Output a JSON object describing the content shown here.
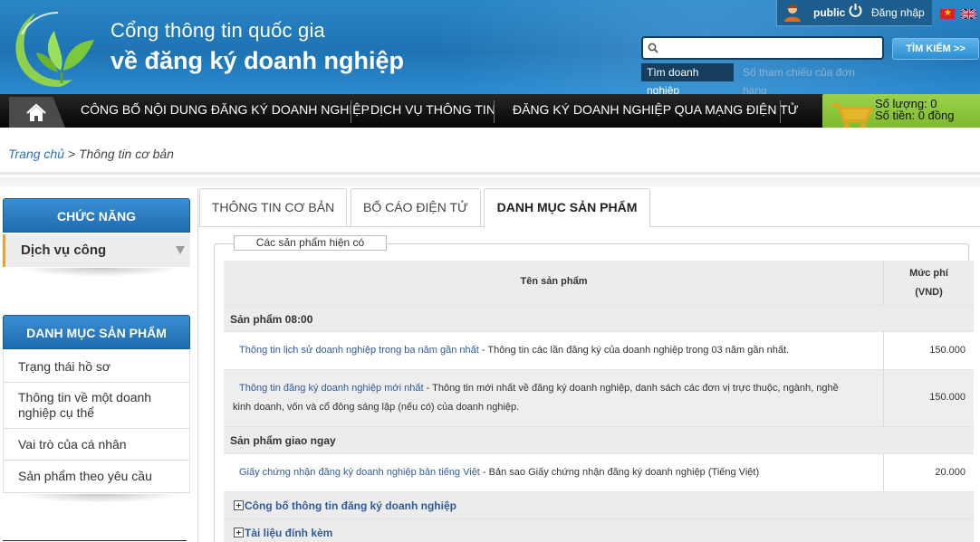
{
  "header": {
    "title_line1": "Cổng thông tin quốc gia",
    "title_line2": "về đăng ký doanh nghiệp",
    "user_name": "public",
    "login_label": "Đăng nhập",
    "search": {
      "placeholder": "",
      "button_label": "TÌM KIẾM >>",
      "tab_company": "Tìm doanh nghiệp",
      "tab_order_ref": "Số tham chiếu của đơn hàng"
    }
  },
  "nav": {
    "items": [
      {
        "label": "CÔNG BỐ NỘI DUNG ĐĂNG KÝ DOANH NGHIỆP"
      },
      {
        "label": "DỊCH VỤ THÔNG TIN"
      },
      {
        "label": "ĐĂNG KÝ DOANH NGHIỆP QUA MẠNG ĐIỆN TỬ"
      }
    ]
  },
  "cart": {
    "quantity": "Số lượng: 0",
    "amount": "Số tiền: 0 đồng"
  },
  "breadcrumb": {
    "home": "Trang chủ",
    "separator": " > ",
    "current": "Thông tin cơ bản"
  },
  "sidebar": {
    "functions_title": "CHỨC NĂNG",
    "functions_item": "Dịch vụ công",
    "products_title": "DANH MỤC SẢN PHẨM",
    "products_items": [
      {
        "label": "Trạng thái hồ sơ"
      },
      {
        "label": "Thông tin về một doanh nghiệp cụ thể"
      },
      {
        "label": "Vai trò của cá nhân"
      },
      {
        "label": "Sản phẩm theo yêu cầu"
      }
    ]
  },
  "tabs": [
    {
      "label": "THÔNG TIN CƠ BẢN"
    },
    {
      "label": "BỐ CÁO ĐIỆN TỬ"
    },
    {
      "label": "DANH MỤC SẢN PHẨM",
      "active": true
    }
  ],
  "products": {
    "legend": "Các sản phẩm hiện có",
    "col_name": "Tên sản phẩm",
    "col_fee_line1": "Mức phí",
    "col_fee_line2": "(VND)",
    "groups": [
      {
        "title": "Sản phẩm 08:00",
        "items": [
          {
            "name": "Thông tin lịch sử doanh nghiệp trong ba năm gần nhất",
            "desc": " - Thông tin các lần đăng ký của doanh nghiệp trong 03 năm gần nhất.",
            "fee": "150.000"
          },
          {
            "name": "Thông tin đăng ký doanh nghiệp mới nhất",
            "desc": " - Thông tin mới nhất về đăng ký doanh nghiệp, danh sách các đơn vị trực thuộc, ngành, nghề kinh doanh, vốn và cổ đông sáng lập (nếu có) của doanh nghiệp.",
            "fee": "150.000"
          }
        ]
      },
      {
        "title": "Sản phẩm giao ngay",
        "items": [
          {
            "name": "Giấy chứng nhận đăng ký doanh nghiệp bản tiếng Việt",
            "desc": " - Bản sao Giấy chứng nhận đăng ký doanh nghiệp (Tiếng Việt)",
            "fee": "20.000"
          }
        ]
      }
    ],
    "expanders": [
      {
        "label": "Công bố thông tin đăng ký doanh nghiệp"
      },
      {
        "label": "Tài liệu đính kèm"
      }
    ]
  },
  "colors": {
    "header_blue": "#1e73b3",
    "nav_black": "#000000",
    "cart_green": "#86c23a",
    "sidebar_head_blue": "#1f6bb0",
    "accent_orange": "#f0a125",
    "link_blue": "#2f5b9a"
  }
}
